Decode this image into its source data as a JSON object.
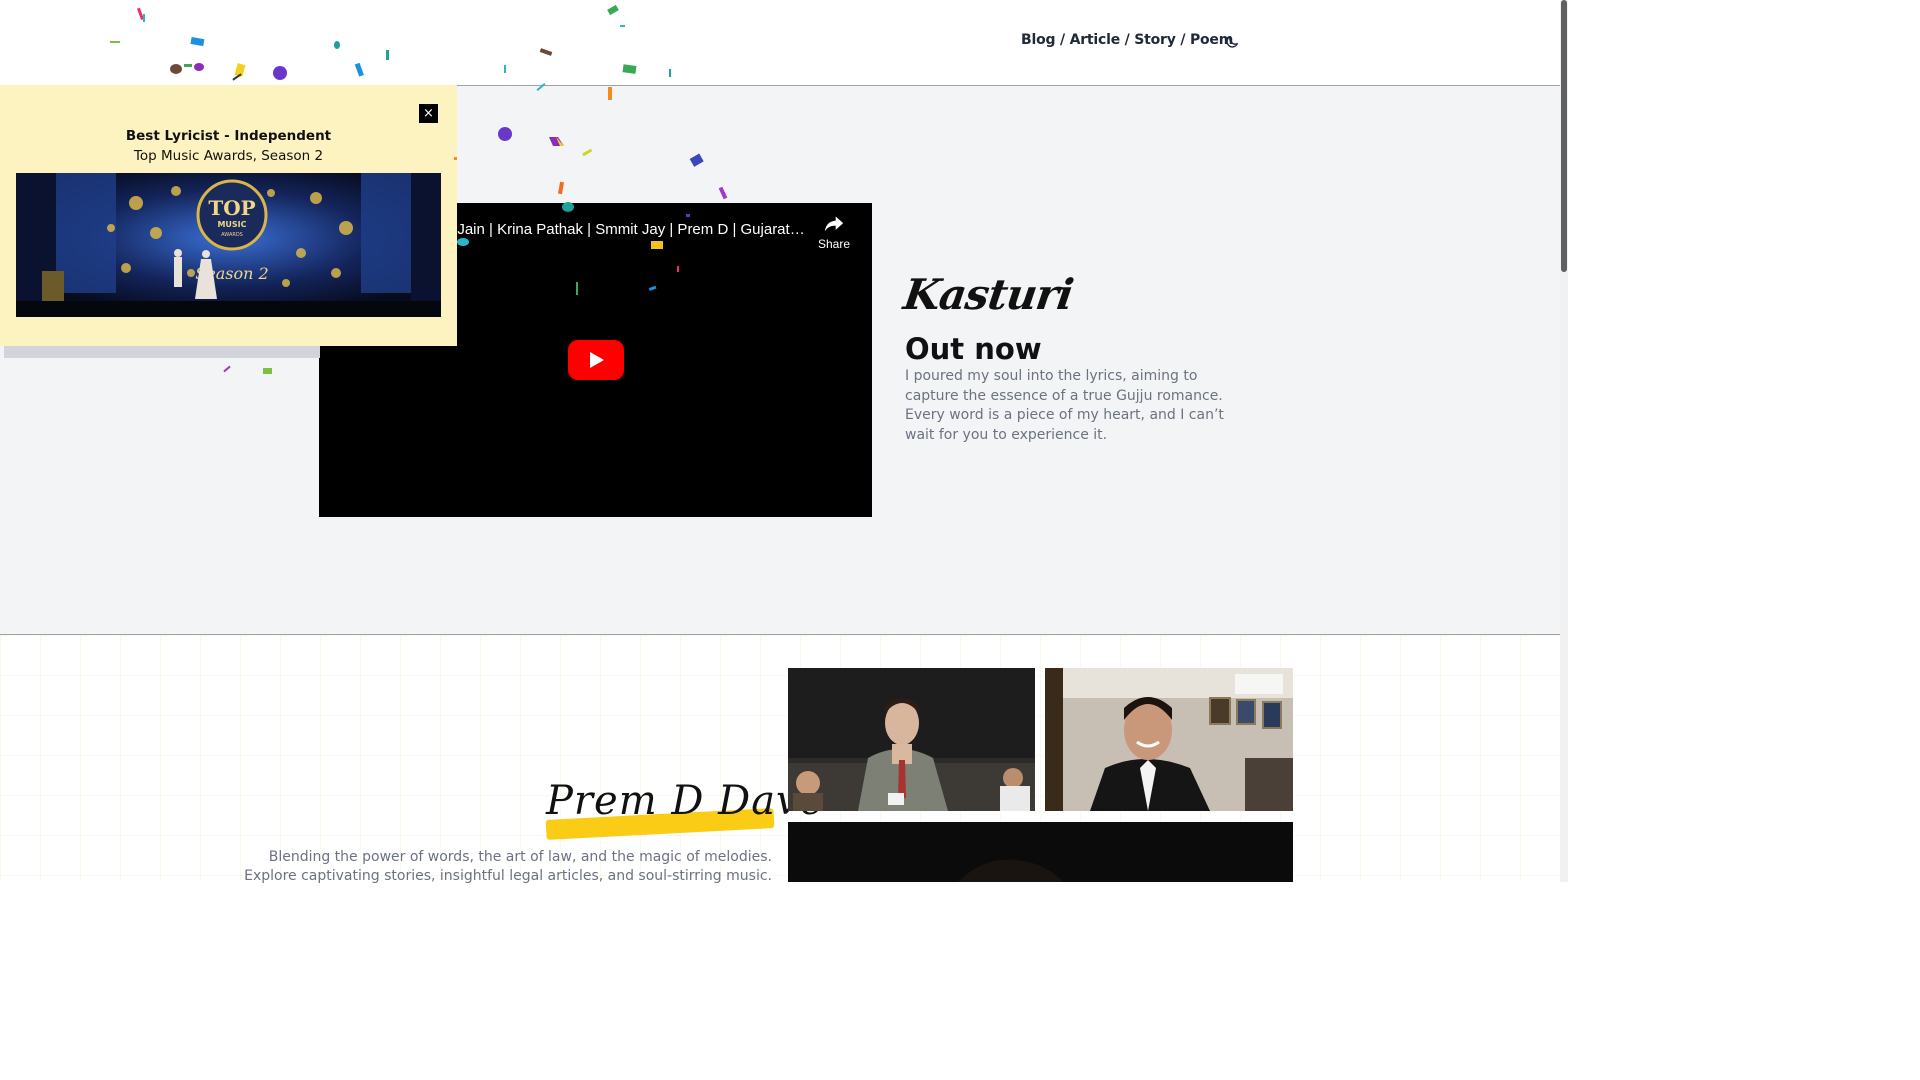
{
  "header": {
    "nav_link": "Blog / Article / Story / Poem",
    "theme_toggle_icon": "moon-icon"
  },
  "hero": {
    "script_title": "Kasturi",
    "heading": "Out now",
    "paragraph_1": "I poured my soul into the lyrics, aiming to capture the essence of a true Gujju romance.",
    "paragraph_2": "Every word is a piece of my heart, and I can’t wait for you to experience it.",
    "video": {
      "title": "t Jain | Krina Pathak | Smmit Jay | Prem D | Gujarat…",
      "share_label": "Share",
      "play_icon": "youtube-play-icon"
    }
  },
  "popup": {
    "close_label": "×",
    "title": "Best Lyricist - Independent",
    "subtitle": "Top Music Awards, Season 2",
    "image_text": {
      "logo_top": "TOP",
      "logo_music": "MUSIC",
      "logo_awards": "AWARDS",
      "season": "Season 2"
    }
  },
  "about": {
    "name": "Prem D Dave",
    "line_1": "Blending the power of words, the art of law, and the magic of melodies.",
    "line_2": "Explore captivating stories, insightful legal articles, and soul-stirring music."
  },
  "colors": {
    "popup_bg": "#fdf3c0",
    "hero_bg": "#f3f4f6",
    "highlight": "#facc15",
    "youtube_red": "#ff0000"
  }
}
